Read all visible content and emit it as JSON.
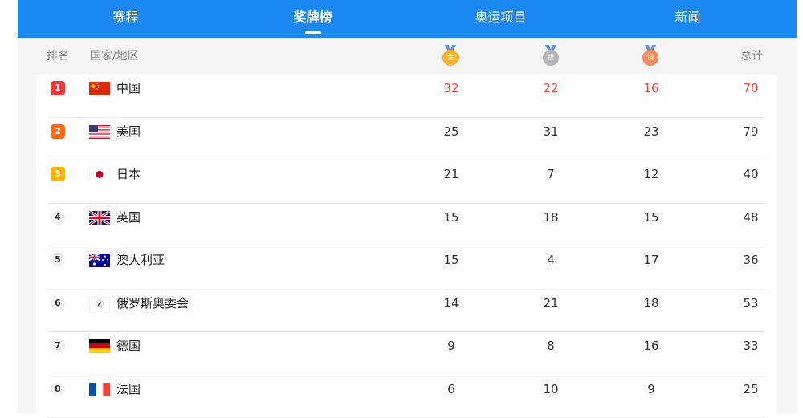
{
  "nav": {
    "tabs": [
      {
        "label": "赛程",
        "active": false
      },
      {
        "label": "奖牌榜",
        "active": true
      },
      {
        "label": "奥运项目",
        "active": false
      },
      {
        "label": "新闻",
        "active": false
      }
    ]
  },
  "header": {
    "rank_label": "排名",
    "country_label": "国家/地区",
    "gold_glyph": "金",
    "silver_glyph": "银",
    "bronze_glyph": "铜",
    "total_label": "总计"
  },
  "colors": {
    "nav_bg": "#1a88f0",
    "highlight_text": "#f0443c",
    "rank1": "#f0353b",
    "rank2": "#ff6a14",
    "rank3": "#ffb200",
    "gold": "#f6b42a",
    "silver": "#b4b4b4",
    "bronze": "#ef8c5a"
  },
  "medals": [
    {
      "rank": "1",
      "country": "中国",
      "flag": "china-flag-icon",
      "gold": "32",
      "silver": "22",
      "bronze": "16",
      "total": "70"
    },
    {
      "rank": "2",
      "country": "美国",
      "flag": "usa-flag-icon",
      "gold": "25",
      "silver": "31",
      "bronze": "23",
      "total": "79"
    },
    {
      "rank": "3",
      "country": "日本",
      "flag": "japan-flag-icon",
      "gold": "21",
      "silver": "7",
      "bronze": "12",
      "total": "40"
    },
    {
      "rank": "4",
      "country": "英国",
      "flag": "uk-flag-icon",
      "gold": "15",
      "silver": "18",
      "bronze": "15",
      "total": "48"
    },
    {
      "rank": "5",
      "country": "澳大利亚",
      "flag": "australia-flag-icon",
      "gold": "15",
      "silver": "4",
      "bronze": "17",
      "total": "36"
    },
    {
      "rank": "6",
      "country": "俄罗斯奥委会",
      "flag": "roc-flag-icon",
      "gold": "14",
      "silver": "21",
      "bronze": "18",
      "total": "53"
    },
    {
      "rank": "7",
      "country": "德国",
      "flag": "germany-flag-icon",
      "gold": "9",
      "silver": "8",
      "bronze": "16",
      "total": "33"
    },
    {
      "rank": "8",
      "country": "法国",
      "flag": "france-flag-icon",
      "gold": "6",
      "silver": "10",
      "bronze": "9",
      "total": "25"
    }
  ]
}
